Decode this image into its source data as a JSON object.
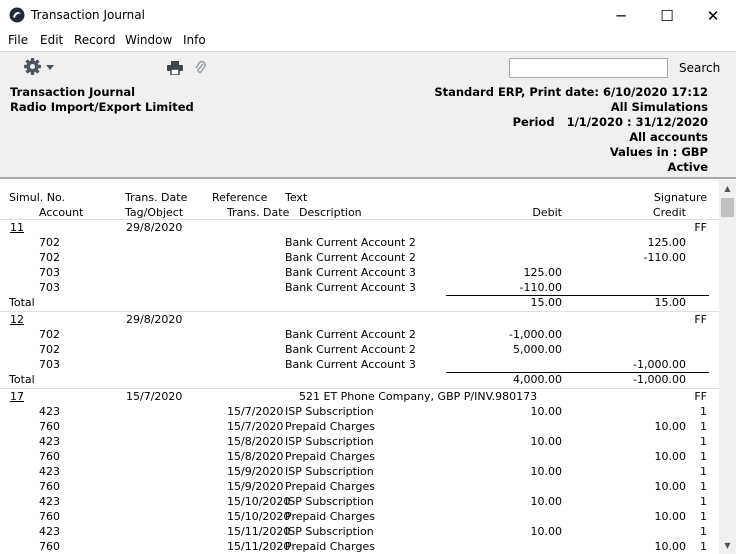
{
  "window": {
    "title": "Transaction Journal",
    "minimize": "─",
    "maximize": "☐",
    "close": "✕"
  },
  "menu": [
    "File",
    "Edit",
    "Record",
    "Window",
    "Info"
  ],
  "toolbar": {
    "search_label": "Search",
    "search_value": ""
  },
  "header": {
    "left": [
      "Transaction Journal",
      "Radio Import/Export Limited"
    ],
    "right": [
      "Standard ERP, Print date: 6/10/2020 17:12",
      "All Simulations",
      "Period   1/1/2020 : 31/12/2020",
      "All accounts",
      "Values in : GBP",
      "Active"
    ]
  },
  "columns": {
    "row1": {
      "simul_no": "Simul. No.",
      "trans_date": "Trans. Date",
      "reference": "Reference",
      "text": "Text",
      "signature": "Signature"
    },
    "row2": {
      "account": "Account",
      "tag_object": "Tag/Object",
      "trans_date": "Trans. Date",
      "description": "Description",
      "debit": "Debit",
      "credit": "Credit"
    }
  },
  "transactions": [
    {
      "no": "11",
      "date": "29/8/2020",
      "text": "",
      "sig": "FF",
      "rows": [
        {
          "account": "702",
          "tdate": "",
          "desc": "Bank Current Account 2",
          "debit": "",
          "credit": "125.00",
          "q": ""
        },
        {
          "account": "702",
          "tdate": "",
          "desc": "Bank Current Account 2",
          "debit": "",
          "credit": "-110.00",
          "q": ""
        },
        {
          "account": "703",
          "tdate": "",
          "desc": "Bank Current Account 3",
          "debit": "125.00",
          "credit": "",
          "q": ""
        },
        {
          "account": "703",
          "tdate": "",
          "desc": "Bank Current Account 3",
          "debit": "-110.00",
          "credit": "",
          "q": ""
        }
      ],
      "total": {
        "label": "Total",
        "debit": "15.00",
        "credit": "15.00"
      }
    },
    {
      "no": "12",
      "date": "29/8/2020",
      "text": "",
      "sig": "FF",
      "rows": [
        {
          "account": "702",
          "tdate": "",
          "desc": "Bank Current Account 2",
          "debit": "-1,000.00",
          "credit": "",
          "q": ""
        },
        {
          "account": "702",
          "tdate": "",
          "desc": "Bank Current Account 2",
          "debit": "5,000.00",
          "credit": "",
          "q": ""
        },
        {
          "account": "703",
          "tdate": "",
          "desc": "Bank Current Account 3",
          "debit": "",
          "credit": "-1,000.00",
          "q": ""
        }
      ],
      "total": {
        "label": "Total",
        "debit": "4,000.00",
        "credit": "-1,000.00"
      }
    },
    {
      "no": "17",
      "date": "15/7/2020",
      "text": "521 ET Phone Company, GBP  P/INV.980173",
      "sig": "FF",
      "rows": [
        {
          "account": "423",
          "tdate": "15/7/2020",
          "desc": "ISP Subscription",
          "debit": "10.00",
          "credit": "",
          "q": "1"
        },
        {
          "account": "760",
          "tdate": "15/7/2020",
          "desc": "Prepaid Charges",
          "debit": "",
          "credit": "10.00",
          "q": "1"
        },
        {
          "account": "423",
          "tdate": "15/8/2020",
          "desc": "ISP Subscription",
          "debit": "10.00",
          "credit": "",
          "q": "1"
        },
        {
          "account": "760",
          "tdate": "15/8/2020",
          "desc": "Prepaid Charges",
          "debit": "",
          "credit": "10.00",
          "q": "1"
        },
        {
          "account": "423",
          "tdate": "15/9/2020",
          "desc": "ISP Subscription",
          "debit": "10.00",
          "credit": "",
          "q": "1"
        },
        {
          "account": "760",
          "tdate": "15/9/2020",
          "desc": "Prepaid Charges",
          "debit": "",
          "credit": "10.00",
          "q": "1"
        },
        {
          "account": "423",
          "tdate": "15/10/2020",
          "desc": "ISP Subscription",
          "debit": "10.00",
          "credit": "",
          "q": "1"
        },
        {
          "account": "760",
          "tdate": "15/10/2020",
          "desc": "Prepaid Charges",
          "debit": "",
          "credit": "10.00",
          "q": "1"
        },
        {
          "account": "423",
          "tdate": "15/11/2020",
          "desc": "ISP Subscription",
          "debit": "10.00",
          "credit": "",
          "q": "1"
        },
        {
          "account": "760",
          "tdate": "15/11/2020",
          "desc": "Prepaid Charges",
          "debit": "",
          "credit": "10.00",
          "q": "1"
        }
      ]
    }
  ],
  "icons": {
    "app": "app-globe-icon",
    "settings": "gear-icon",
    "print": "printer-icon",
    "attach": "paperclip-icon"
  }
}
